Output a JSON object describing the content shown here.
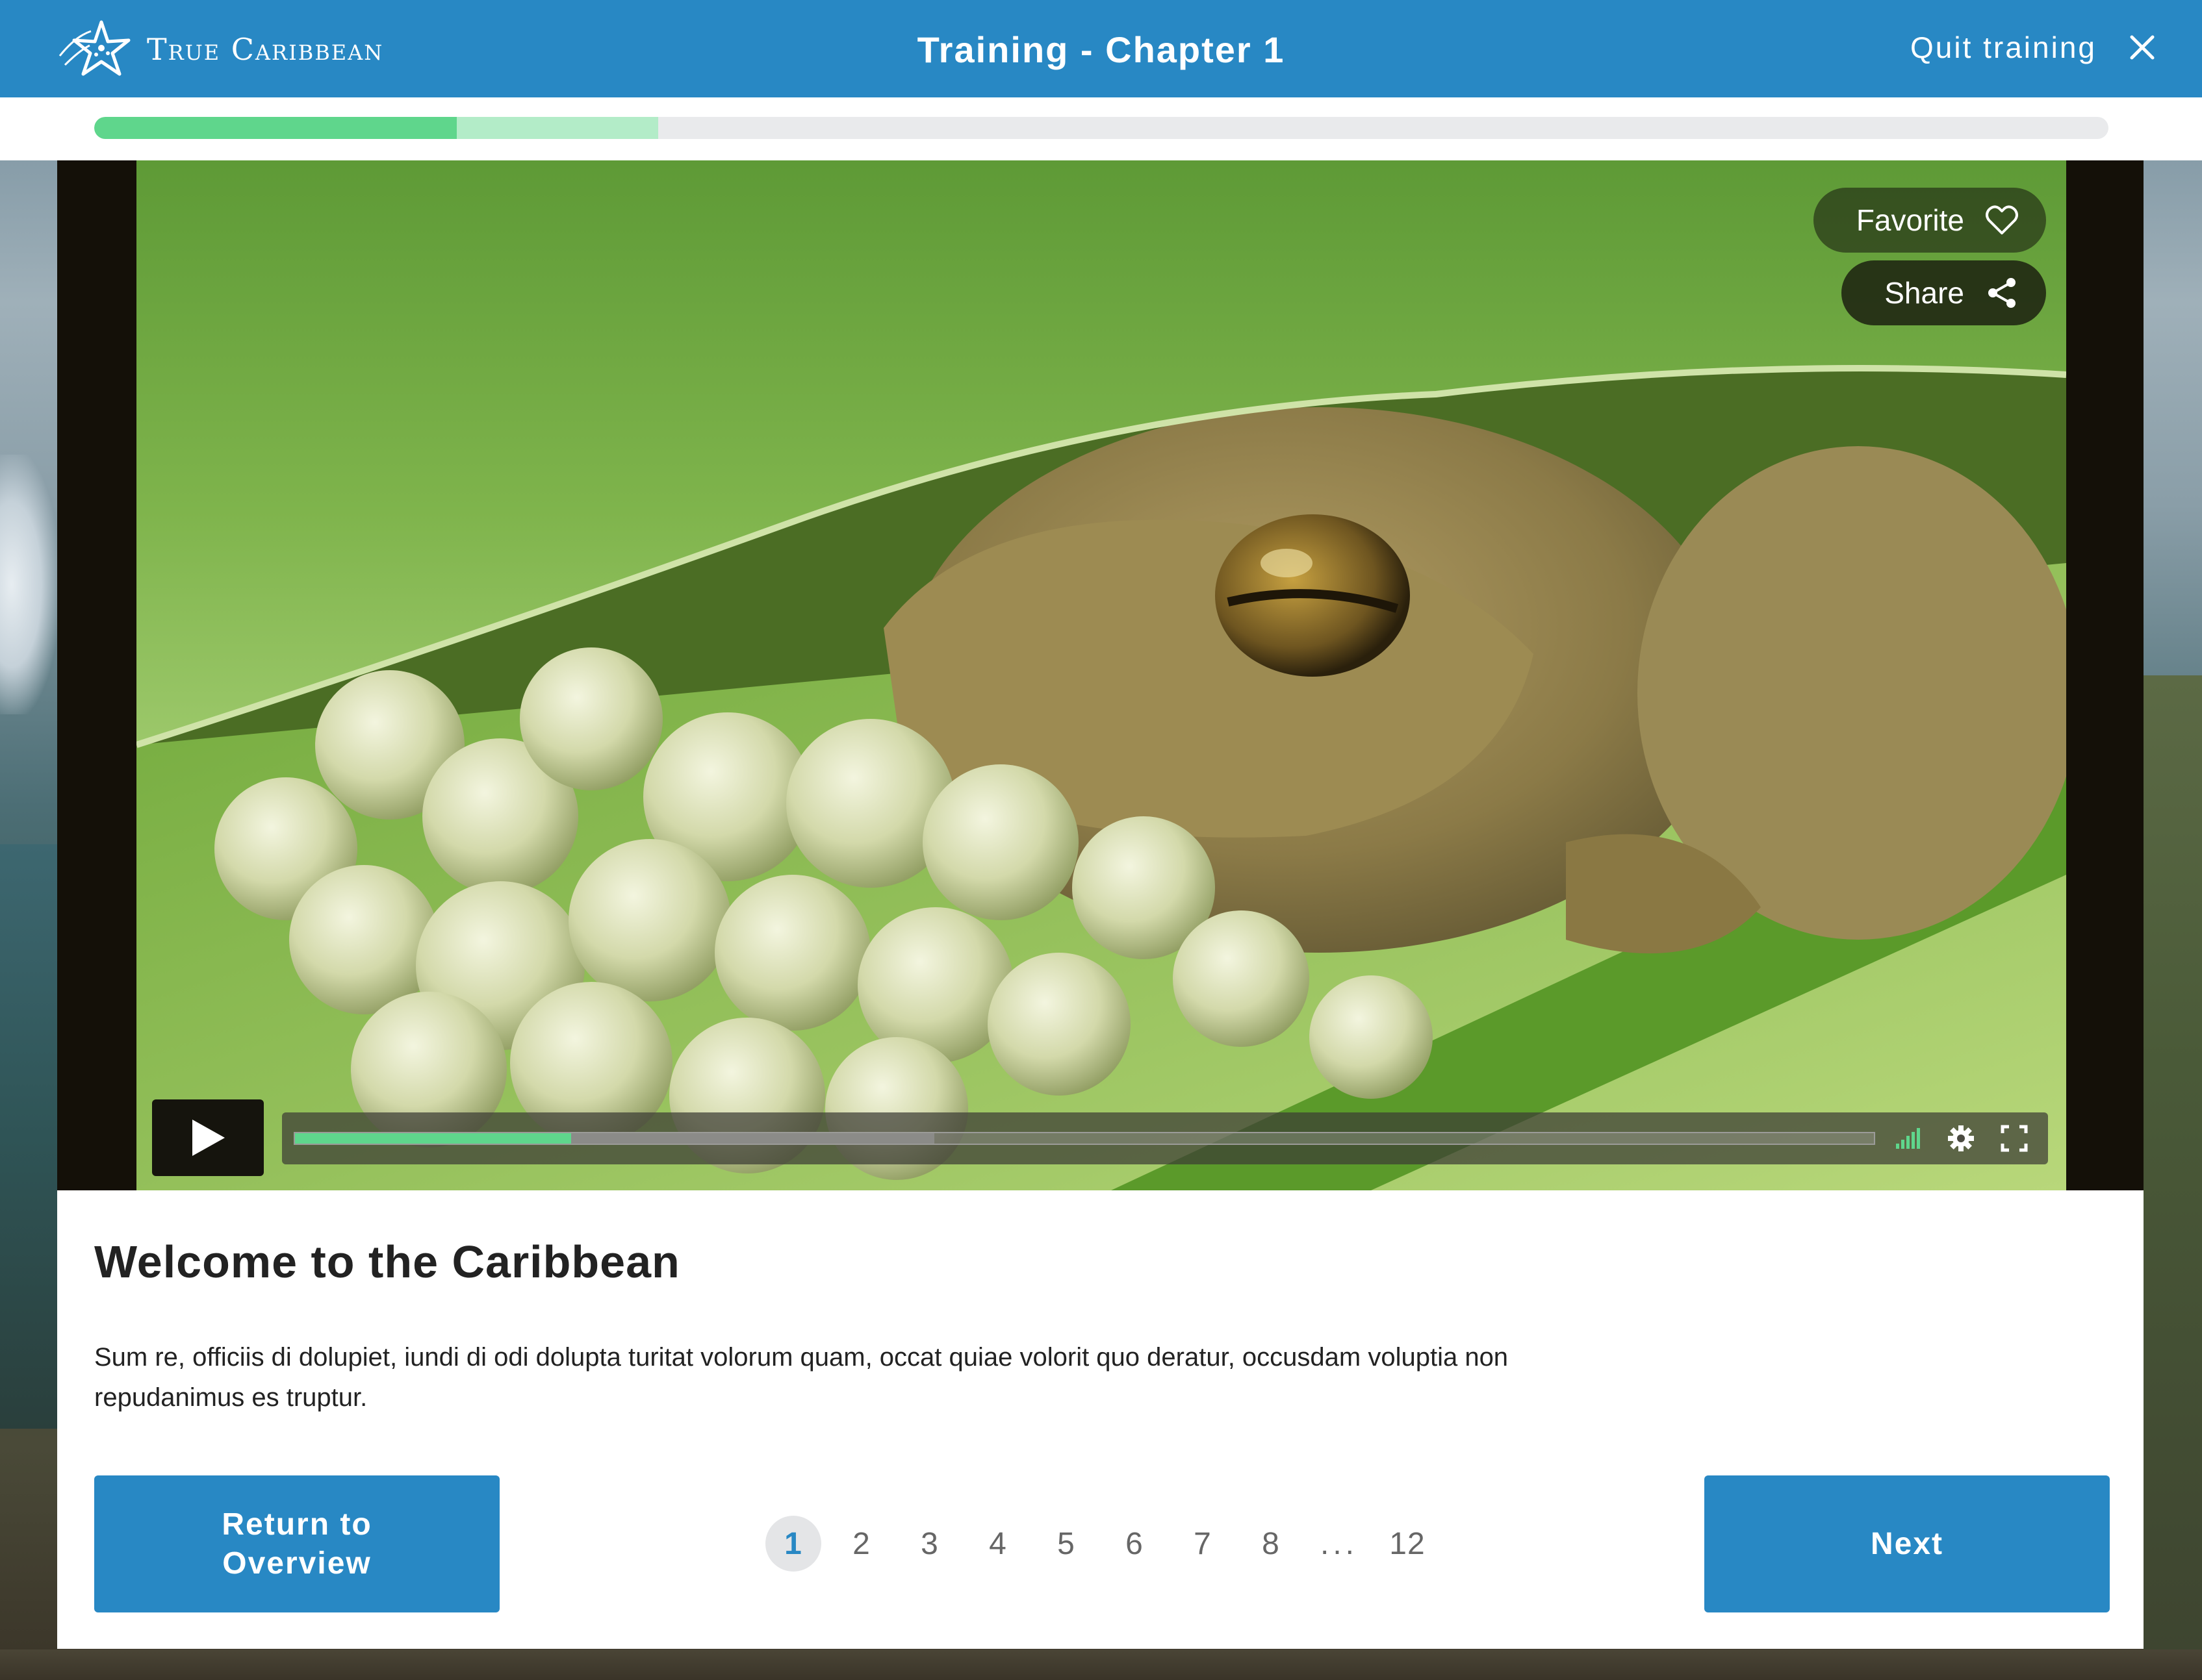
{
  "header": {
    "brand": "True Caribbean",
    "title": "Training - Chapter 1",
    "quit_label": "Quit training"
  },
  "progress": {
    "completed_fraction": 0.18,
    "in_progress_fraction": 0.28
  },
  "video": {
    "favorite_label": "Favorite",
    "share_label": "Share",
    "played_fraction": 0.175,
    "buffered_fraction": 0.405,
    "icons": [
      "play-icon",
      "signal-icon",
      "settings-icon",
      "fullscreen-icon"
    ]
  },
  "content": {
    "heading": "Welcome to the Caribbean",
    "body": "Sum re, officiis di dolupiet, iundi di odi dolupta turitat volorum quam, occat quiae volorit quo deratur, occusdam voluptia non\n repudanimus es truptur."
  },
  "nav": {
    "return_label": "Return to\nOverview",
    "next_label": "Next",
    "pages": [
      "1",
      "2",
      "3",
      "4",
      "5",
      "6",
      "7",
      "8",
      "...",
      "12"
    ],
    "current_page": "1"
  },
  "colors": {
    "brand_blue": "#2888c4",
    "progress_green": "#5fd68c",
    "progress_light_green": "#b3ecc8"
  }
}
